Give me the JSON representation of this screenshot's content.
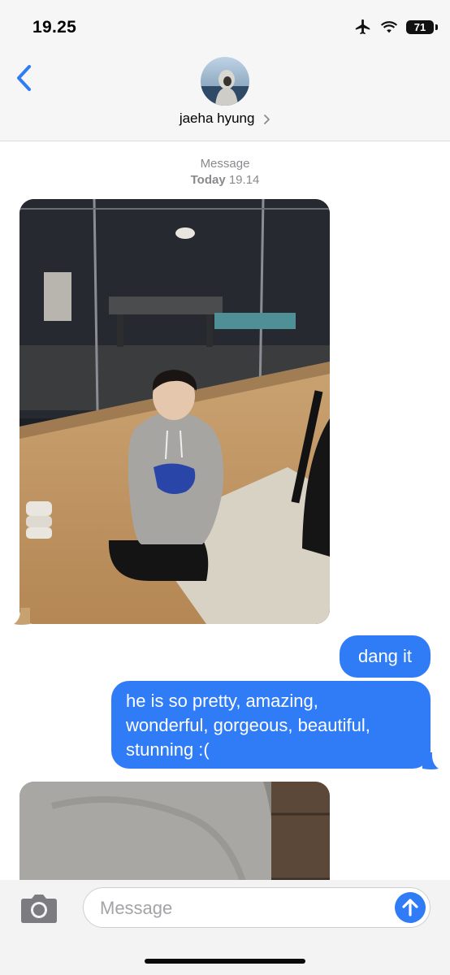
{
  "status_bar": {
    "time": "19.25",
    "battery": "71",
    "icons": [
      "airplane-icon",
      "wifi-icon",
      "battery-icon"
    ]
  },
  "header": {
    "contact_name": "jaeha hyung",
    "back_icon": "chevron-left-icon",
    "name_chevron": "chevron-right-icon"
  },
  "thread": {
    "service_label": "Message",
    "date_label": "Today",
    "time_label": "19.14",
    "messages": [
      {
        "direction": "incoming",
        "kind": "photo"
      },
      {
        "direction": "outgoing",
        "kind": "text",
        "text": "dang it"
      },
      {
        "direction": "outgoing",
        "kind": "text",
        "lines": [
          "he is so pretty, amazing,",
          "wonderful, gorgeous, beautiful,",
          "stunning :("
        ]
      },
      {
        "direction": "incoming",
        "kind": "photo"
      }
    ]
  },
  "composer": {
    "placeholder": "Message",
    "value": "",
    "camera_icon": "camera-icon",
    "send_icon": "arrow-up-icon"
  },
  "colors": {
    "accent": "#2f7cf6",
    "bar_background": "#f6f6f6",
    "meta_text": "#8a8a8e"
  }
}
